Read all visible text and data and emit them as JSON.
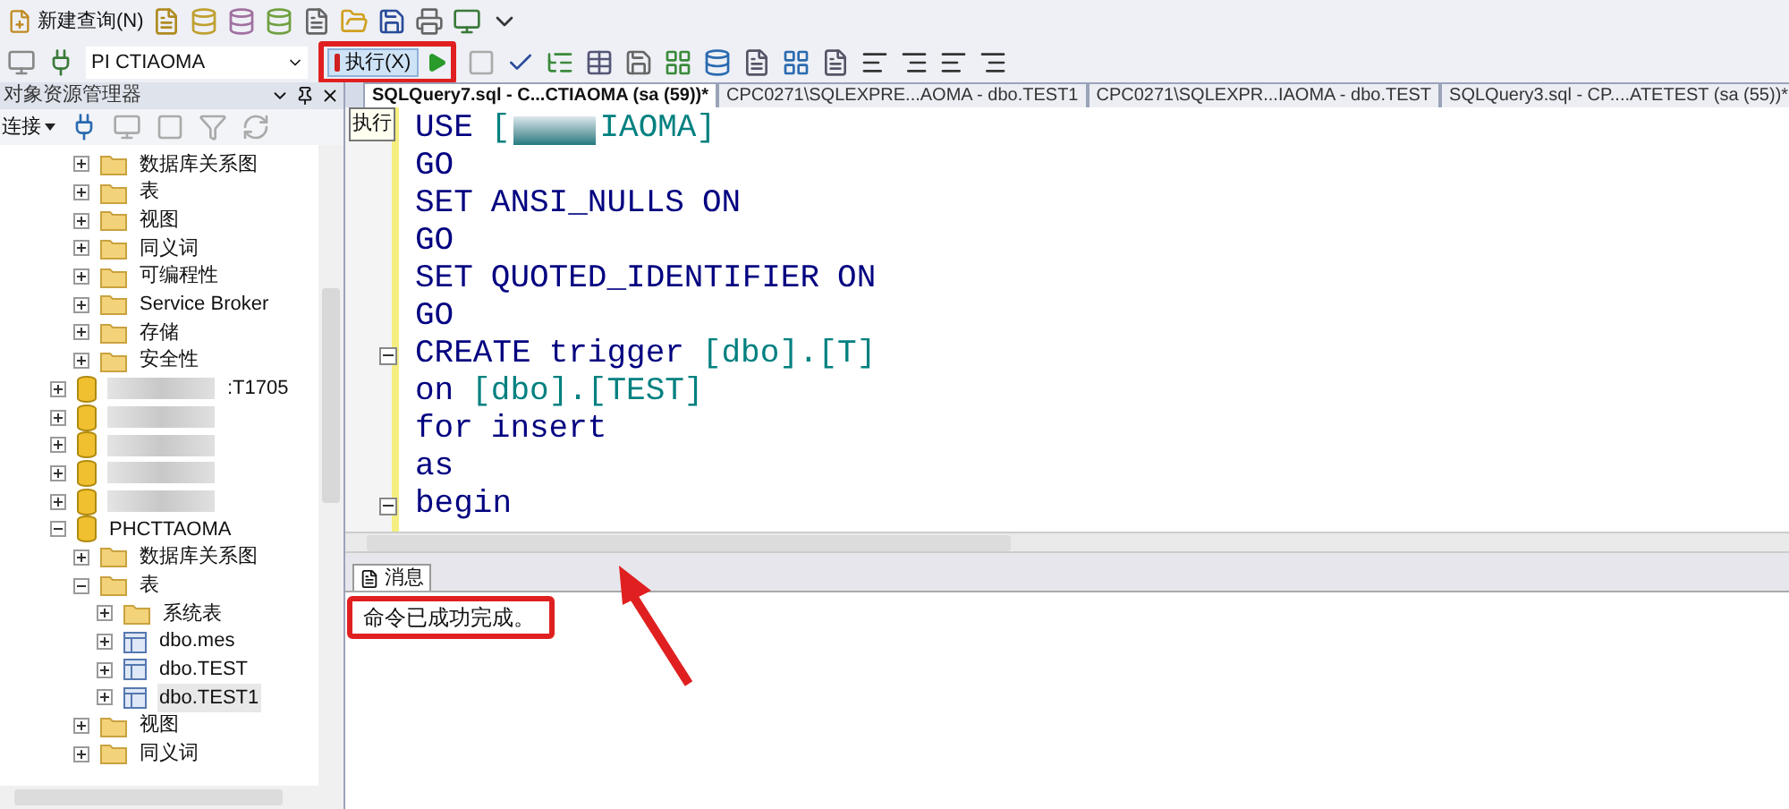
{
  "toolbar": {
    "new_query": "新建查询(N)"
  },
  "query_bar": {
    "database": "PI  CTIAOMA",
    "execute": "执行(X)",
    "execute_tooltip": "执行"
  },
  "object_explorer": {
    "title": "对象资源管理器",
    "connect": "连接",
    "partial_node_children": [
      {
        "kind": "folder",
        "name": "数据库关系图",
        "expanded": false
      },
      {
        "kind": "folder",
        "name": "表",
        "expanded": false
      },
      {
        "kind": "folder",
        "name": "视图",
        "expanded": false
      },
      {
        "kind": "folder",
        "name": "同义词",
        "expanded": false
      },
      {
        "kind": "folder",
        "name": "可编程性",
        "expanded": false
      },
      {
        "kind": "folder",
        "name": "Service Broker",
        "expanded": false
      },
      {
        "kind": "folder",
        "name": "存储",
        "expanded": false
      },
      {
        "kind": "folder",
        "name": "安全性",
        "expanded": false
      }
    ],
    "tree": [
      {
        "kind": "database",
        "name": ":T1705",
        "blurred": true,
        "expanded": false
      },
      {
        "kind": "database",
        "blurred": true,
        "expanded": false
      },
      {
        "kind": "database",
        "blurred": true,
        "expanded": false
      },
      {
        "kind": "database",
        "blurred": true,
        "expanded": false
      },
      {
        "kind": "database",
        "blurred": true,
        "expanded": false
      },
      {
        "kind": "database",
        "name": "PHCTTAOMA",
        "expanded": true,
        "children": [
          {
            "kind": "folder",
            "name": "数据库关系图",
            "expanded": false
          },
          {
            "kind": "folder",
            "name": "表",
            "expanded": true,
            "children": [
              {
                "kind": "folder",
                "name": "系统表",
                "expanded": false
              },
              {
                "kind": "table",
                "name": "dbo.mes",
                "expanded": false
              },
              {
                "kind": "table",
                "name": "dbo.TEST",
                "expanded": false
              },
              {
                "kind": "table",
                "name": "dbo.TEST1",
                "expanded": false,
                "selected": true
              }
            ]
          },
          {
            "kind": "folder",
            "name": "视图",
            "expanded": false
          },
          {
            "kind": "folder",
            "name": "同义词",
            "expanded": false
          }
        ]
      }
    ]
  },
  "editor_tabs": [
    {
      "label": "SQLQuery7.sql - C...CTIAOMA (sa (59))*",
      "selected": true
    },
    {
      "label": "CPC0271\\SQLEXPRE...AOMA - dbo.TEST1",
      "selected": false
    },
    {
      "label": "CPC0271\\SQLEXPR...IAOMA - dbo.TEST",
      "selected": false
    },
    {
      "label": "SQLQuery3.sql - CP....ATETEST (sa (55))*",
      "selected": false
    }
  ],
  "code": [
    {
      "tokens": [
        {
          "kind": "keyword",
          "text": "USE"
        },
        {
          "kind": "ident",
          "text": "["
        },
        {
          "kind": "redacted"
        },
        {
          "kind": "ident",
          "text": "IAOMA]"
        }
      ]
    },
    {
      "tokens": [
        {
          "kind": "keyword",
          "text": "GO"
        }
      ]
    },
    {
      "tokens": [
        {
          "kind": "keyword",
          "text": "SET"
        },
        {
          "kind": "keyword",
          "text": "ANSI_NULLS"
        },
        {
          "kind": "keyword",
          "text": "ON"
        }
      ]
    },
    {
      "tokens": [
        {
          "kind": "keyword",
          "text": "GO"
        }
      ]
    },
    {
      "tokens": [
        {
          "kind": "keyword",
          "text": "SET"
        },
        {
          "kind": "keyword",
          "text": "QUOTED_IDENTIFIER"
        },
        {
          "kind": "keyword",
          "text": "ON"
        }
      ]
    },
    {
      "tokens": [
        {
          "kind": "keyword",
          "text": "GO"
        }
      ]
    },
    {
      "fold": true,
      "tokens": [
        {
          "kind": "keyword",
          "text": "CREATE"
        },
        {
          "kind": "keyword",
          "text": "trigger"
        },
        {
          "kind": "ident",
          "text": "[dbo].[T]"
        }
      ]
    },
    {
      "tokens": [
        {
          "kind": "keyword",
          "text": "on"
        },
        {
          "kind": "ident",
          "text": "[dbo].[TEST]"
        }
      ]
    },
    {
      "tokens": [
        {
          "kind": "keyword",
          "text": "for"
        },
        {
          "kind": "keyword",
          "text": "insert"
        }
      ]
    },
    {
      "tokens": [
        {
          "kind": "keyword",
          "text": "as"
        }
      ]
    },
    {
      "fold": true,
      "tokens": [
        {
          "kind": "keyword",
          "text": "begin"
        }
      ]
    }
  ],
  "messages": {
    "tab": "消息",
    "text": "命令已成功完成。"
  }
}
